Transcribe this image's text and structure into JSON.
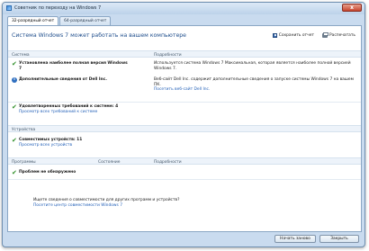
{
  "window": {
    "title": "Советник по переходу на Windows 7",
    "close_label": "x"
  },
  "tabs": [
    {
      "label": "32-разрядный отчет",
      "active": true
    },
    {
      "label": "64-разрядный отчет",
      "active": false
    }
  ],
  "header": {
    "heading": "Система Windows 7 может работать на вашем компьютере",
    "save_label": "Сохранить отчет",
    "print_label": "Распечатать"
  },
  "system_section": {
    "col1": "Система",
    "col2": "Подробности",
    "rows": [
      {
        "status": "ok",
        "label": "Установлена наиболее полная версия Windows 7",
        "detail": "Используется система Windows 7 Максимальная, которая является наиболее полной версией Windows 7.",
        "link": ""
      },
      {
        "status": "info",
        "label": "Дополнительные сведения от Dell Inc.",
        "detail": "Веб-сайт Dell Inc. содержит дополнительные сведения о запуске системы Windows 7 на вашем ПК.",
        "link": "Посетить веб-сайт Dell Inc."
      },
      {
        "status": "ok",
        "label": "Удовлетворенных требований к системе: 4",
        "detail": "",
        "link": "Просмотр всех требований к системе"
      }
    ]
  },
  "devices_section": {
    "col1": "Устройства",
    "rows": [
      {
        "status": "ok",
        "label": "Совместимых устройств: 11",
        "link": "Просмотр всех устройств"
      }
    ]
  },
  "programs_section": {
    "col1": "Программы",
    "col2": "Состояние",
    "col3": "Подробности",
    "rows": [
      {
        "status": "ok",
        "label": "Проблем не обнаружено"
      }
    ],
    "question": "Ищете сведения о совместимости для других программ и устройств?",
    "compat_link": "Посетите центр совместимости Windows 7"
  },
  "footer": {
    "restart_label": "Начать заново",
    "close_label": "Закрыть"
  },
  "colors": {
    "heading": "#1f4e8c",
    "link": "#2461b8",
    "check": "#2f8f28"
  }
}
